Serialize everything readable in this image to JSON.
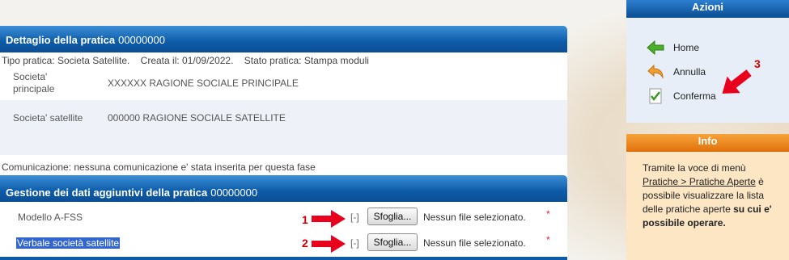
{
  "detail": {
    "title": "Dettaglio della pratica",
    "number": "00000000",
    "tipo_label": "Tipo pratica:",
    "tipo_value": "Societa Satellite.",
    "creata_label": "Creata il:",
    "creata_value": "01/09/2022.",
    "stato_label": "Stato pratica:",
    "stato_value": "Stampa moduli",
    "rows": [
      {
        "label": "Societa' principale",
        "value": "XXXXXX RAGIONE SOCIALE PRINCIPALE"
      },
      {
        "label": "Societa' satellite",
        "value": "000000 RAGIONE SOCIALE SATELLITE"
      }
    ],
    "communication": "Comunicazione: nessuna comunicazione e' stata inserita per questa fase"
  },
  "additional": {
    "title": "Gestione dei dati aggiuntivi della pratica",
    "number": "00000000",
    "files": [
      {
        "label": "Modello A-FSS",
        "toggle": "[-]",
        "button": "Sfoglia...",
        "status": "Nessun file selezionato.",
        "required": "*",
        "marker": "1"
      },
      {
        "label": "Verbale società satellite",
        "toggle": "[-]",
        "button": "Sfoglia...",
        "status": "Nessun file selezionato.",
        "required": "*",
        "marker": "2"
      }
    ]
  },
  "actions": {
    "title": "Azioni",
    "items": [
      {
        "label": "Home",
        "icon": "green-arrow-left-icon"
      },
      {
        "label": "Annulla",
        "icon": "undo-arrow-icon"
      },
      {
        "label": "Conferma",
        "icon": "document-check-icon"
      }
    ],
    "marker": "3"
  },
  "info": {
    "title": "Info",
    "text_1": "Tramite la voce di menù",
    "link": "Pratiche > Pratiche Aperte",
    "text_2": "è possibile visualizzare la lista delle pratiche aperte",
    "text_bold": "su cui e' possibile operare."
  },
  "colors": {
    "header_blue": "#0d5ba8",
    "info_orange": "#e0700a",
    "marker_red": "#d10000"
  }
}
